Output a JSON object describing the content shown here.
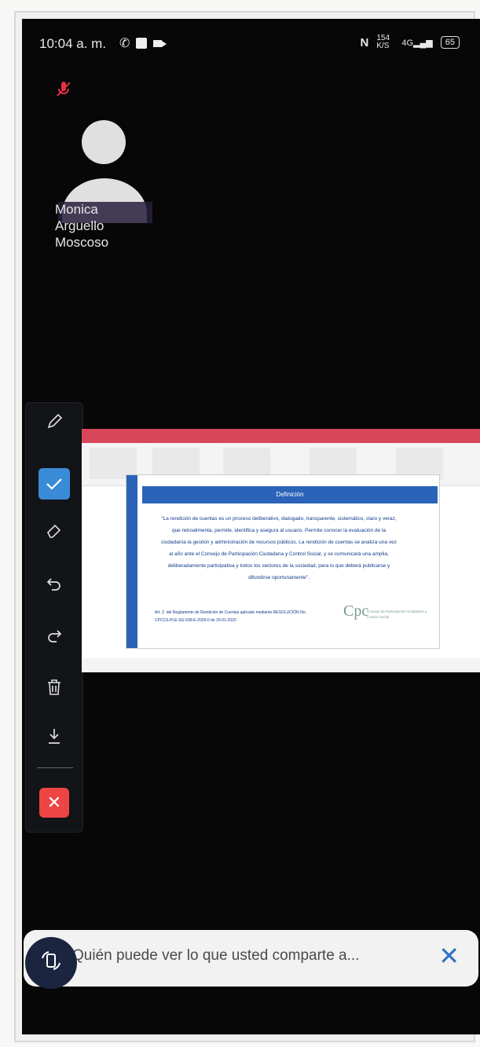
{
  "status_bar": {
    "time": "10:04 a. m.",
    "network_speed": "154 K/S",
    "network_type": "4G",
    "battery": "65"
  },
  "participant": {
    "name_line1": "Monica",
    "name_line2": "Arguello",
    "name_line3": "Moscoso",
    "muted": true
  },
  "toolbar": {
    "tools": [
      "pencil-icon",
      "check-icon",
      "eraser-icon",
      "undo-icon",
      "redo-icon",
      "trash-icon",
      "download-icon",
      "close-icon"
    ],
    "active_tool": "check-icon",
    "accent_color": "#3a8bd6",
    "close_color": "#e44444"
  },
  "shared_screen": {
    "slide_header": "Definición",
    "slide_body": "\"La rendición de cuentas es un proceso deliberativo, dialogado, transparente, sistemático, claro y veraz, que retroalimenta, permite, identifica y asegura al usuario. Permite conocer la evaluación de la ciudadanía la gestión y administración de recursos públicos. La rendición de cuentas se analiza una vez al año ante el Consejo de Participación Ciudadana y Control Social, y se comunicará una amplia, deliberadamente participativa y todos los sectores de la sociedad, para lo que deberá publicarse y difundirse oportunamente\".",
    "slide_footnote": "Art. 2. del Reglamento de Rendición de Cuentas aplicado mediante RESOLUCIÓN No. CPCCS-PLE-SG-039-E-2020-0 de 20-01-2020",
    "logo_text": "Consejo de Participación Ciudadana y Control Social",
    "accent_blue": "#2a63b8",
    "ribbon_red": "#d9465a"
  },
  "banner": {
    "message": "Quién puede ver lo que usted comparte a...",
    "close_label": "✕",
    "close_color": "#2d72c6"
  }
}
